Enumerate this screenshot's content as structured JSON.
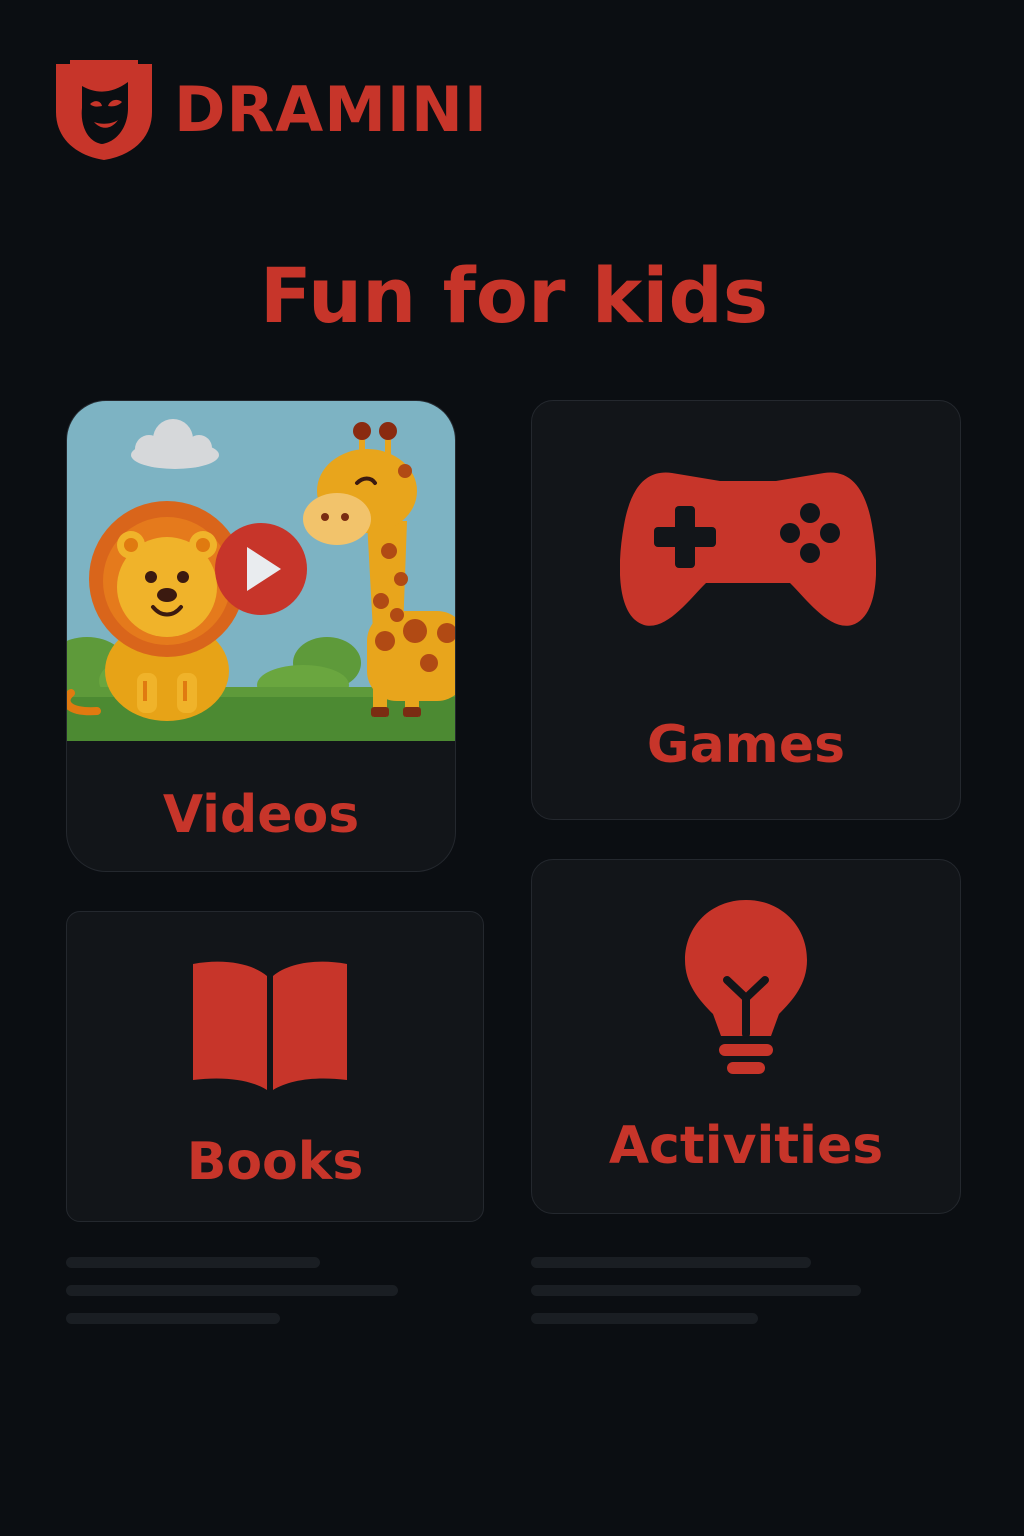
{
  "brand": {
    "name": "DRAMINI",
    "logo_icon": "theater-mask-shield-icon",
    "color": "#c7352a"
  },
  "page": {
    "title": "Fun for kids"
  },
  "cards": {
    "videos": {
      "label": "Videos",
      "thumbnail": "lion-and-giraffe-cartoon",
      "overlay_icon": "play-icon"
    },
    "games": {
      "label": "Games",
      "icon": "gamepad-icon"
    },
    "books": {
      "label": "Books",
      "icon": "open-book-icon"
    },
    "activities": {
      "label": "Activities",
      "icon": "lightbulb-icon"
    }
  },
  "colors": {
    "background": "#0b0e12",
    "card": "#121519",
    "card_border": "#24282e",
    "accent": "#c7352a",
    "skeleton": "#1a1e23"
  }
}
